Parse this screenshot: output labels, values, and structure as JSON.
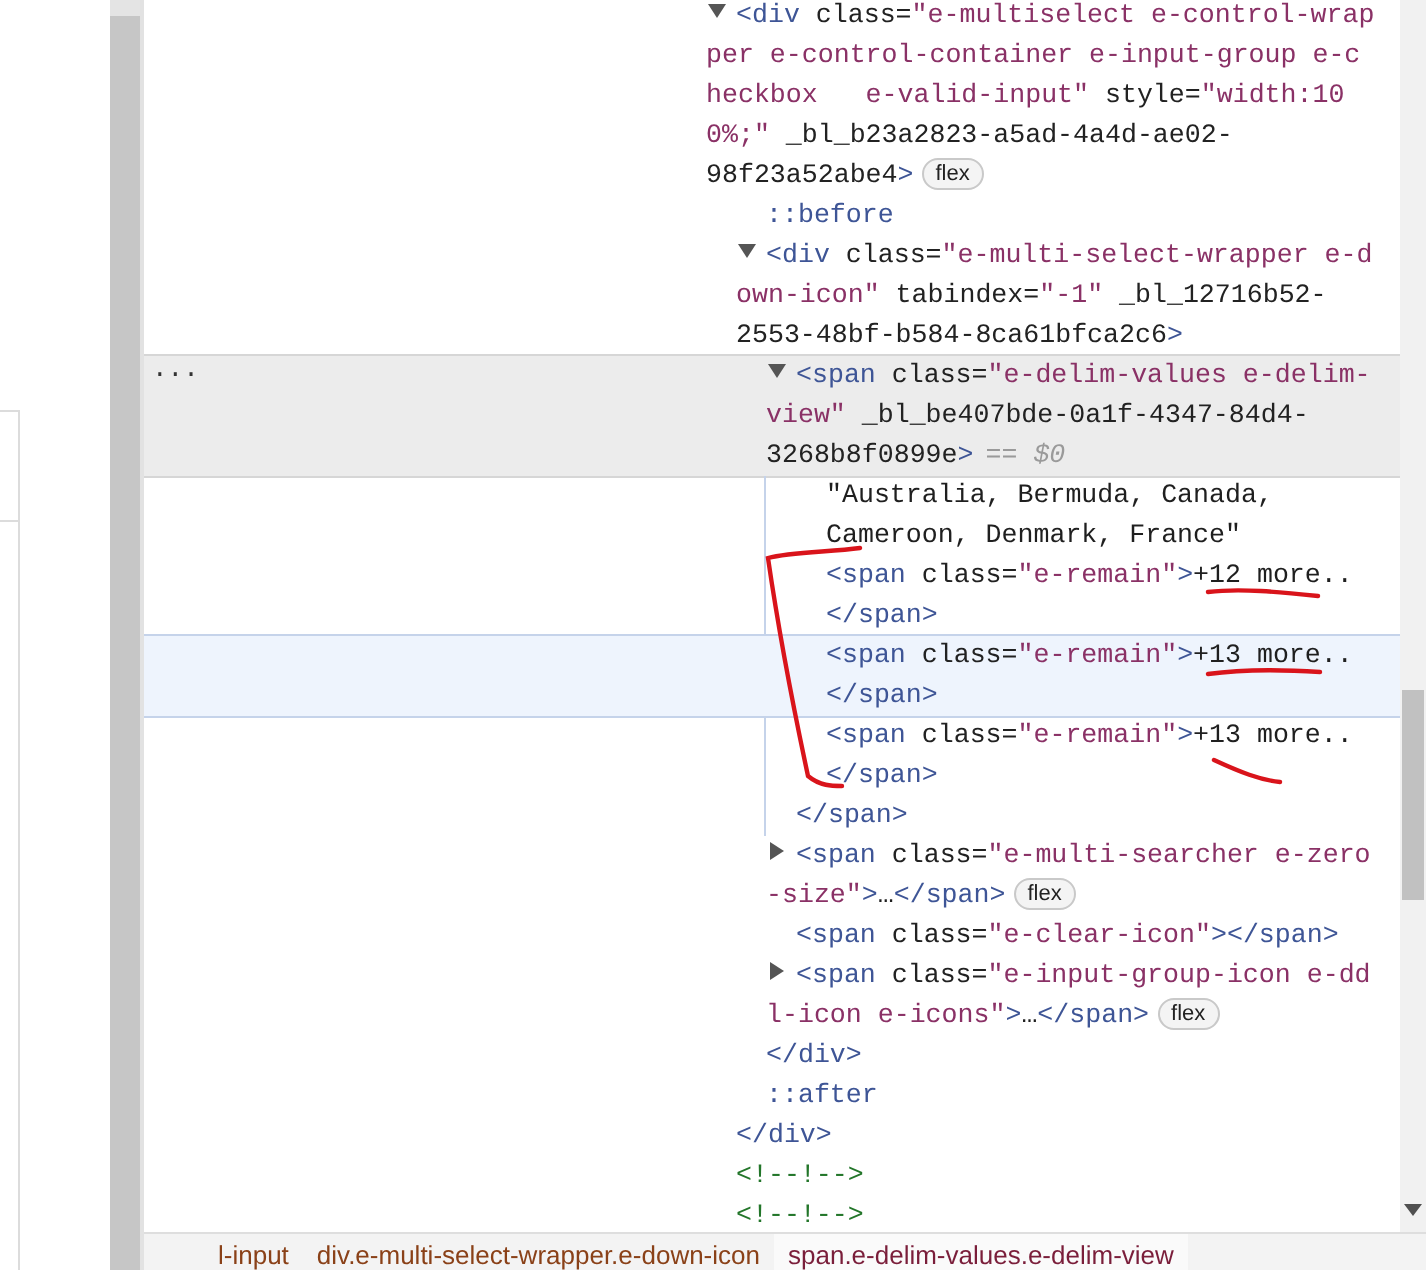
{
  "dom_tree": {
    "nodes": [
      {
        "kind": "element",
        "lines": [
          "<div class=\"e-multiselect e-control-wrap",
          "per e-control-container e-input-group e-c",
          "heckbox   e-valid-input\" style=\"width:10",
          "0%;\" _bl_b23a2823-a5ad-4a4d-ae02-",
          "98f23a52abe4>"
        ],
        "badge": "flex",
        "expanded": true,
        "selected": false,
        "hovered": false,
        "closing": "</div>",
        "children": [
          {
            "kind": "pseudo",
            "lines": [
              "::before"
            ],
            "selected": false,
            "hovered": false
          },
          {
            "kind": "element",
            "lines": [
              "<div class=\"e-multi-select-wrapper e-d",
              "own-icon\" tabindex=\"-1\" _bl_12716b52-",
              "2553-48bf-b584-8ca61bfca2c6>"
            ],
            "expanded": true,
            "selected": false,
            "hovered": false,
            "closing": "</div>",
            "children": [
              {
                "kind": "element",
                "lines": [
                  "<span class=\"e-delim-values e-delim-",
                  "view\" _bl_be407bde-0a1f-4347-84d4-",
                  "3268b8f0899e>"
                ],
                "ref": "== $0",
                "actions": "...",
                "expanded": true,
                "selected": true,
                "hovered": false,
                "closing": "</span>",
                "children": [
                  {
                    "kind": "text",
                    "lines": [
                      "\"Australia, Bermuda, Canada,",
                      "Cameroon, Denmark, France\""
                    ],
                    "selected": false,
                    "hovered": false
                  },
                  {
                    "kind": "element",
                    "lines": [
                      "<span class=\"e-remain\">+12 more..",
                      "</span>"
                    ],
                    "selected": false,
                    "hovered": false
                  },
                  {
                    "kind": "element",
                    "lines": [
                      "<span class=\"e-remain\">+13 more..",
                      "</span>"
                    ],
                    "selected": false,
                    "hovered": true
                  },
                  {
                    "kind": "element",
                    "lines": [
                      "<span class=\"e-remain\">+13 more..",
                      "</span>"
                    ],
                    "selected": false,
                    "hovered": false
                  }
                ]
              },
              {
                "kind": "element",
                "lines": [
                  "<span class=\"e-multi-searcher e-zero",
                  "-size\">…</span>"
                ],
                "badge": "flex",
                "expanded": false,
                "selected": false,
                "hovered": false
              },
              {
                "kind": "element",
                "lines": [
                  "<span class=\"e-clear-icon\"></span>"
                ],
                "selected": false,
                "hovered": false
              },
              {
                "kind": "element",
                "lines": [
                  "<span class=\"e-input-group-icon e-dd",
                  "l-icon e-icons\">…</span>"
                ],
                "badge": "flex",
                "expanded": false,
                "selected": false,
                "hovered": false
              }
            ]
          },
          {
            "kind": "pseudo",
            "lines": [
              "::after"
            ],
            "selected": false,
            "hovered": false
          }
        ]
      },
      {
        "kind": "comment",
        "lines": [
          "<!--!-->"
        ],
        "selected": false,
        "hovered": false
      },
      {
        "kind": "comment",
        "lines": [
          "<!--!-->"
        ],
        "selected": false,
        "hovered": false
      }
    ]
  },
  "breadcrumbs": [
    {
      "text": "l-input",
      "selected": false
    },
    {
      "text": "div.e-multi-select-wrapper.e-down-icon",
      "selected": false
    },
    {
      "text": "span.e-delim-values.e-delim-view",
      "selected": true
    }
  ]
}
